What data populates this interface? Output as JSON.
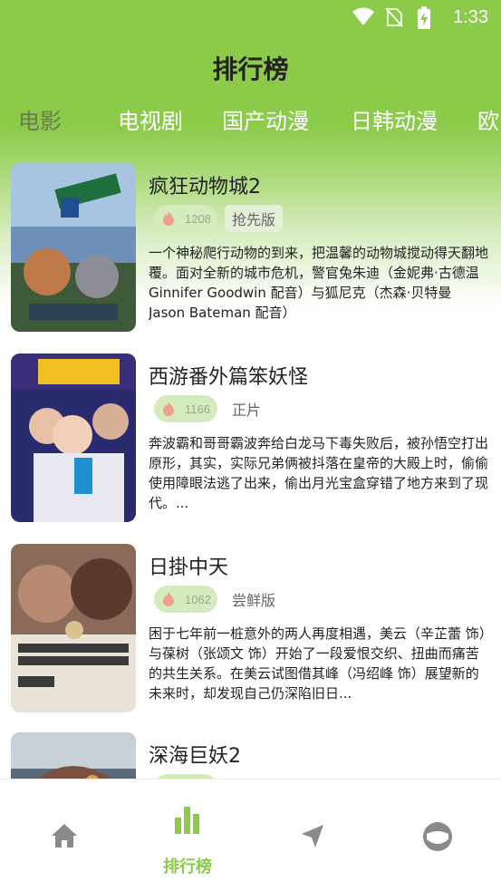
{
  "status_bar": {
    "time": "1:33"
  },
  "header": {
    "title": "排行榜"
  },
  "tabs": [
    {
      "label": "电影",
      "active": true
    },
    {
      "label": "电视剧",
      "active": false
    },
    {
      "label": "国产动漫",
      "active": false
    },
    {
      "label": "日韩动漫",
      "active": false
    },
    {
      "label": "欧",
      "active": false
    }
  ],
  "movies": [
    {
      "title": "疯狂动物城2",
      "hot": "1208",
      "tag": "抢先版",
      "description": "一个神秘爬行动物的到来，把温馨的动物城搅动得天翻地覆。面对全新的城市危机，警官兔朱迪（金妮弗·古德温 Ginnifer Goodwin 配音）与狐尼克（杰森·贝特曼 Jason Bateman 配音）"
    },
    {
      "title": "西游番外篇笨妖怪",
      "hot": "1166",
      "tag": "正片",
      "description": "奔波霸和哥哥霸波奔给白龙马下毒失败后，被孙悟空打出原形，其实，实际兄弟俩被抖落在皇帝的大殿上时，偷偷使用障眼法逃了出来，偷出月光宝盒穿错了地方来到了现代。..."
    },
    {
      "title": "日掛中天",
      "hot": "1062",
      "tag": "尝鲜版",
      "description": "困于七年前一桩意外的两人再度相遇，美云（辛芷蕾 饰）与葆树（张颂文 饰）开始了一段爱恨交织、扭曲而痛苦的共生关系。在美云试图借其峰（冯绍峰 饰）展望新的未来时，却发现自己仍深陷旧日..."
    },
    {
      "title": "深海巨妖2",
      "hot": "",
      "tag": "",
      "description": ""
    }
  ],
  "bottom_nav": {
    "rank_label": "排行榜"
  },
  "colors": {
    "brand_green": "#8ccb4a",
    "badge_bg": "#d4ebbd",
    "active_tab": "#6a7a4e"
  }
}
